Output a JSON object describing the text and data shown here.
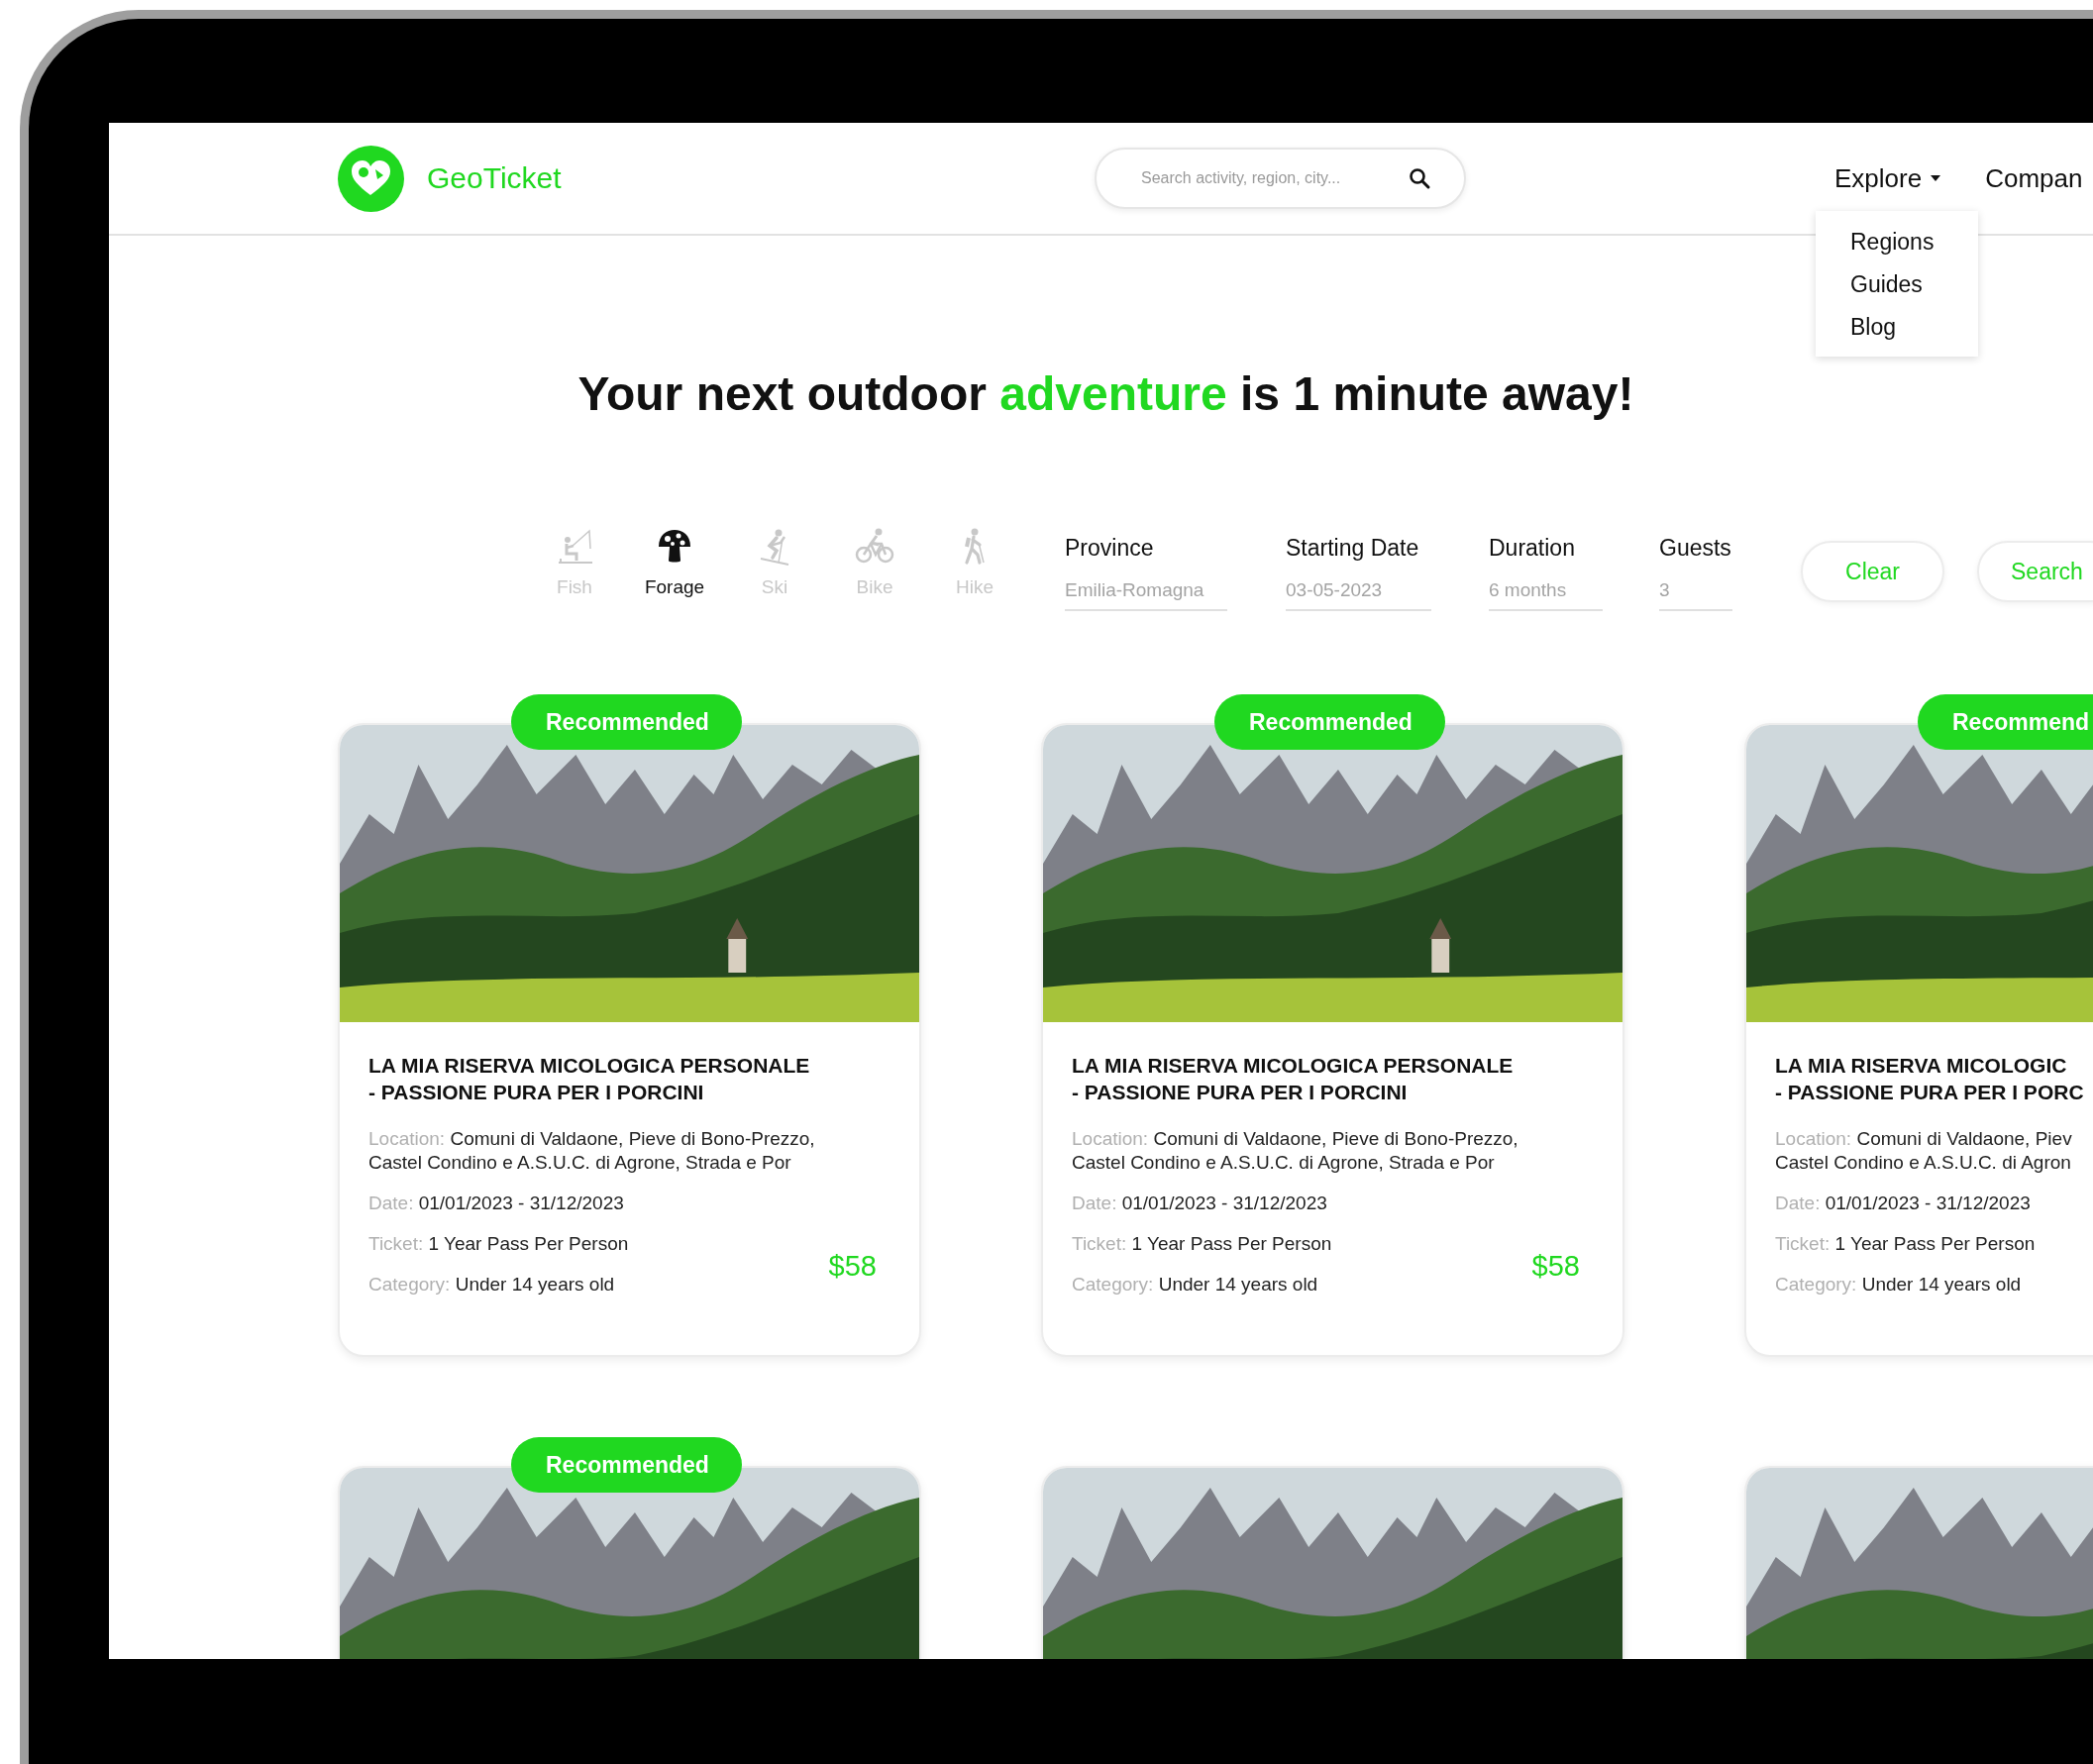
{
  "header": {
    "brand": "GeoTicket",
    "search": {
      "placeholder": "Search activity, region, city..."
    },
    "nav": [
      {
        "label": "Explore",
        "expanded": true,
        "menu": [
          "Regions",
          "Guides",
          "Blog"
        ]
      },
      {
        "label": "Compan"
      }
    ]
  },
  "headline": {
    "before": "Your next outdoor ",
    "highlight": "adventure",
    "after": " is 1 minute away!"
  },
  "filters": {
    "activities": [
      {
        "kind": "fish",
        "label": "Fish",
        "selected": false
      },
      {
        "kind": "forage",
        "label": "Forage",
        "selected": true
      },
      {
        "kind": "ski",
        "label": "Ski",
        "selected": false
      },
      {
        "kind": "bike",
        "label": "Bike",
        "selected": false
      },
      {
        "kind": "hike",
        "label": "Hike",
        "selected": false
      }
    ],
    "fields": [
      {
        "label": "Province",
        "placeholder": "Emilia-Romagna"
      },
      {
        "label": "Starting Date",
        "placeholder": "03-05-2023"
      },
      {
        "label": "Duration",
        "placeholder": "6 months"
      },
      {
        "label": "Guests",
        "placeholder": "3"
      }
    ],
    "buttons": [
      {
        "kind": "clear",
        "label": "Clear"
      },
      {
        "kind": "search",
        "label": "Search"
      }
    ]
  },
  "cards": [
    {
      "recommended": true,
      "badge": "Recommended",
      "title_lines": [
        "LA MIA RISERVA MICOLOGICA PERSONALE",
        "- PASSIONE PURA PER I PORCINI"
      ],
      "details": [
        {
          "label": "Location:",
          "value_lines": [
            "Comuni di Valdaone, Pieve di Bono-Prezzo,",
            "Castel Condino e A.S.U.C. di Agrone, Strada e Por"
          ]
        },
        {
          "label": "Date:",
          "value_lines": [
            "01/01/2023 - 31/12/2023"
          ]
        },
        {
          "label": "Ticket:",
          "value_lines": [
            "1 Year Pass Per Person"
          ]
        },
        {
          "label": "Category:",
          "value_lines": [
            "Under 14 years old"
          ]
        }
      ],
      "price": "$58"
    },
    {
      "recommended": true,
      "badge": "Recommended",
      "title_lines": [
        "LA MIA RISERVA MICOLOGICA PERSONALE",
        "- PASSIONE PURA PER I PORCINI"
      ],
      "details": [
        {
          "label": "Location:",
          "value_lines": [
            "Comuni di Valdaone, Pieve di Bono-Prezzo,",
            "Castel Condino e A.S.U.C. di Agrone, Strada e Por"
          ]
        },
        {
          "label": "Date:",
          "value_lines": [
            "01/01/2023 - 31/12/2023"
          ]
        },
        {
          "label": "Ticket:",
          "value_lines": [
            "1 Year Pass Per Person"
          ]
        },
        {
          "label": "Category:",
          "value_lines": [
            "Under 14 years old"
          ]
        }
      ],
      "price": "$58"
    },
    {
      "recommended": true,
      "badge": "Recommend",
      "title_lines": [
        "LA MIA RISERVA MICOLOGIC",
        "- PASSIONE PURA PER I PORC"
      ],
      "details": [
        {
          "label": "Location:",
          "value_lines": [
            "Comuni di Valdaone, Piev",
            "Castel Condino e A.S.U.C. di Agron"
          ]
        },
        {
          "label": "Date:",
          "value_lines": [
            "01/01/2023 - 31/12/2023"
          ]
        },
        {
          "label": "Ticket:",
          "value_lines": [
            "1 Year Pass Per Person"
          ]
        },
        {
          "label": "Category:",
          "value_lines": [
            "Under 14 years old"
          ]
        }
      ]
    },
    {
      "recommended": true,
      "badge": "Recommended"
    },
    {
      "recommended": false
    },
    {
      "recommended": false
    }
  ]
}
